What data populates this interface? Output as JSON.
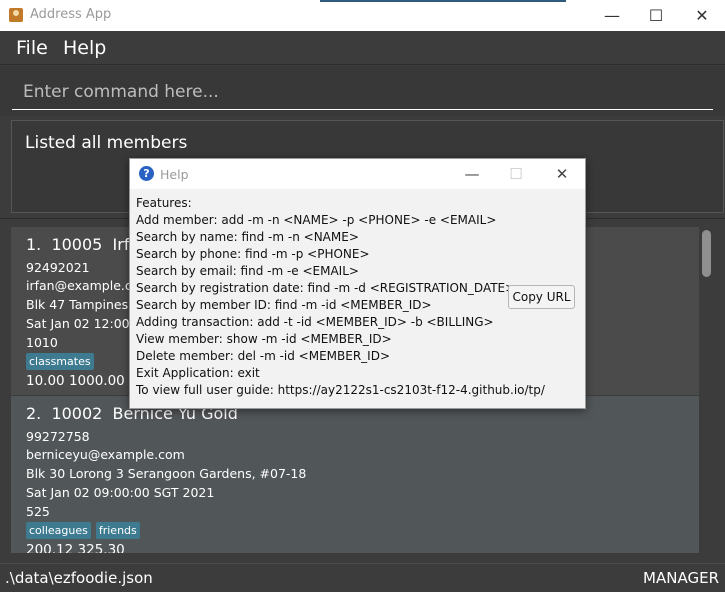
{
  "window": {
    "title": "Address App",
    "controls": {
      "minimize": "—",
      "maximize": "☐",
      "close": "✕"
    }
  },
  "menu": {
    "file": "File",
    "help": "Help"
  },
  "command": {
    "placeholder": "Enter command here..."
  },
  "result": {
    "text": "Listed all members"
  },
  "members": [
    {
      "index": "1.",
      "id": "10005",
      "name": "Irfan",
      "phone": "92492021",
      "email": "irfan@example.co",
      "address": "Blk 47 Tampines S",
      "date": "Sat Jan 02 12:00:0",
      "points": "1010",
      "tags": [
        "classmates"
      ],
      "amounts": "10.00 1000.00"
    },
    {
      "index": "2.",
      "id": "10002",
      "name": "Bernice Yu Gold",
      "phone": "99272758",
      "email": "berniceyu@example.com",
      "address": "Blk 30 Lorong 3 Serangoon Gardens, #07-18",
      "date": "Sat Jan 02 09:00:00 SGT 2021",
      "points": "525",
      "tags": [
        "colleagues",
        "friends"
      ],
      "amounts": "200.12 325.30"
    }
  ],
  "status": {
    "path": ".\\data\\ezfoodie.json",
    "role": "MANAGER"
  },
  "help": {
    "title": "Help",
    "controls": {
      "minimize": "—",
      "maximize": "☐",
      "close": "✕"
    },
    "lines": [
      "Features:",
      "Add member: add -m -n <NAME> -p <PHONE> -e <EMAIL>",
      "Search by name: find -m -n <NAME>",
      "Search by phone: find -m -p <PHONE>",
      "Search by email: find -m -e <EMAIL>",
      "Search by registration date: find -m -d <REGISTRATION_DATE>",
      "Search by member ID: find -m -id <MEMBER_ID>",
      "Adding transaction: add -t -id <MEMBER_ID> -b <BILLING>",
      "View member: show -m -id <MEMBER_ID>",
      "Delete member: del -m -id <MEMBER_ID>",
      "Exit Application: exit",
      "To view full user guide: https://ay2122s1-cs2103t-f12-4.github.io/tp/"
    ],
    "copy_button": "Copy URL"
  }
}
